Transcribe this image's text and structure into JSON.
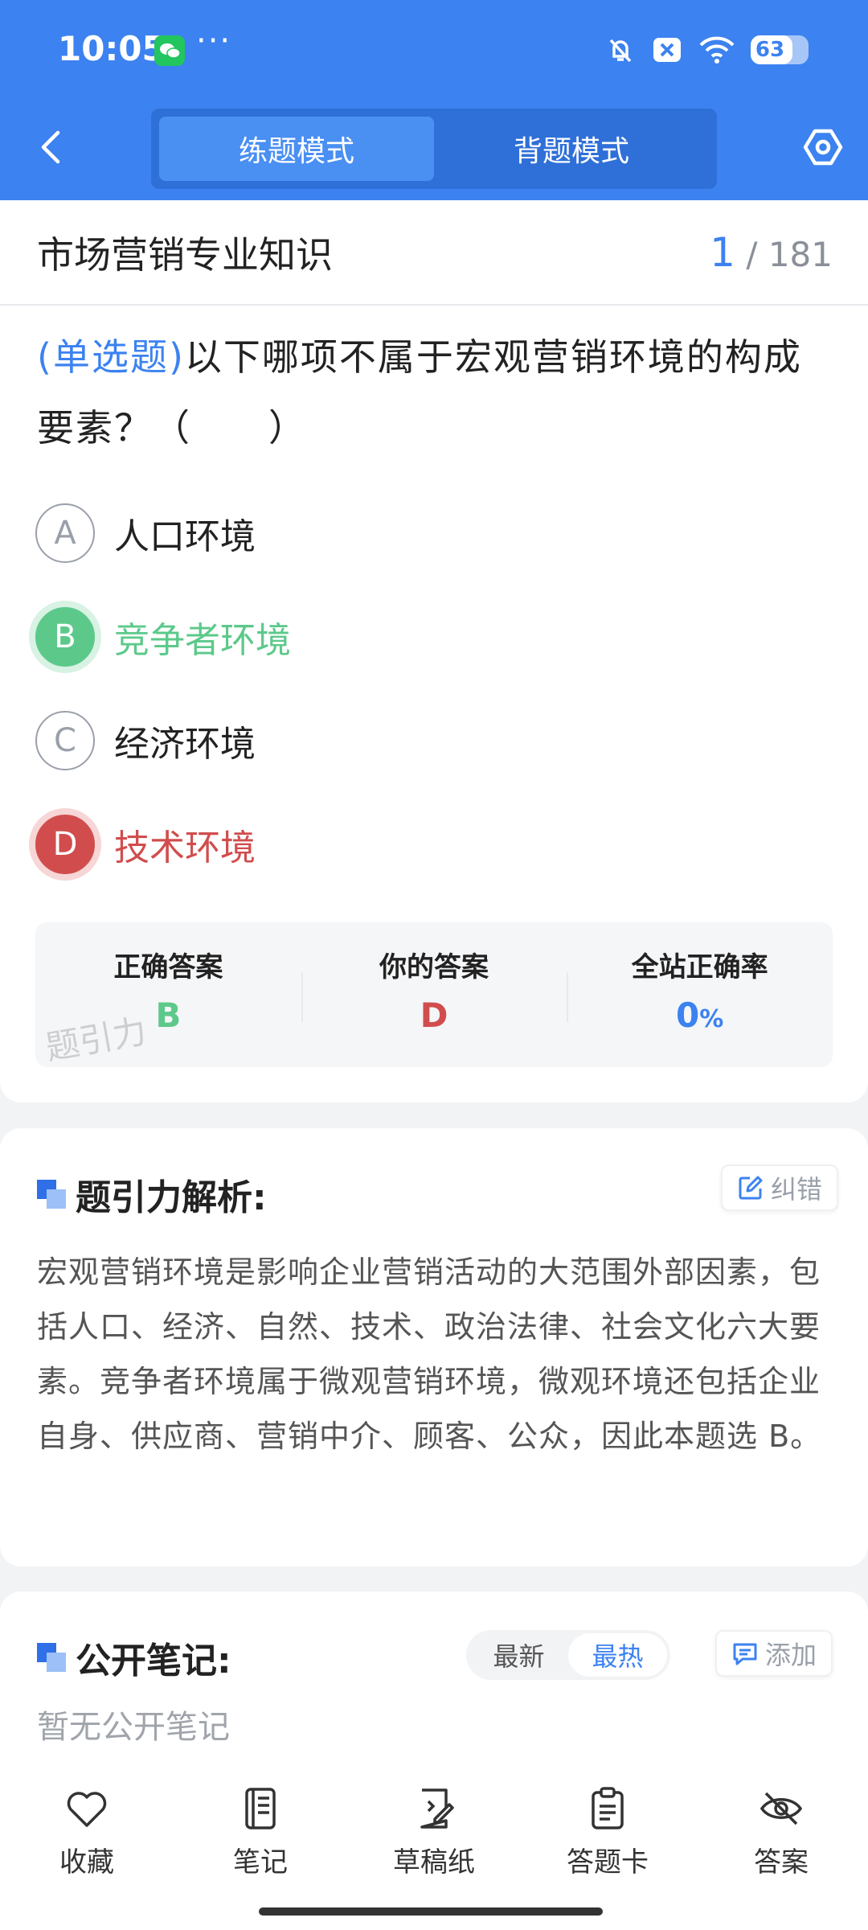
{
  "status_bar": {
    "time": "10:05",
    "dots": "···",
    "battery": "63",
    "icons": [
      "wechat-icon",
      "bell-off-icon",
      "close-box-icon",
      "wifi-icon",
      "battery-icon"
    ]
  },
  "header": {
    "tabs": [
      "练题模式",
      "背题模式"
    ],
    "active_tab": "练题模式"
  },
  "question": {
    "subject": "市场营销专业知识",
    "current": "1",
    "total": "/ 181",
    "type": "(单选题)",
    "text": "以下哪项不属于宏观营销环境的构成要素？（　　）",
    "options": [
      {
        "letter": "A",
        "text": "人口环境",
        "state": "normal"
      },
      {
        "letter": "B",
        "text": "竞争者环境",
        "state": "correct"
      },
      {
        "letter": "C",
        "text": "经济环境",
        "state": "normal"
      },
      {
        "letter": "D",
        "text": "技术环境",
        "state": "wrong"
      }
    ]
  },
  "answers": {
    "correct_label": "正确答案",
    "correct_value": "B",
    "yours_label": "你的答案",
    "yours_value": "D",
    "rate_label": "全站正确率",
    "rate_value": "0",
    "rate_unit": "%",
    "watermark": "题引力"
  },
  "analysis": {
    "title": "题引力解析:",
    "report_label": "纠错",
    "text": "宏观营销环境是影响企业营销活动的大范围外部因素，包括人口、经济、自然、技术、政治法律、社会文化六大要素。竞争者环境属于微观营销环境，微观环境还包括企业自身、供应商、营销中介、顾客、公众，因此本题选 B。"
  },
  "notes": {
    "title": "公开笔记:",
    "sort_options": [
      "最新",
      "最热"
    ],
    "active_sort": "最热",
    "add_label": "添加",
    "empty_text": "暂无公开笔记"
  },
  "toolbar": {
    "items": [
      {
        "label": "收藏",
        "icon": "heart-icon"
      },
      {
        "label": "笔记",
        "icon": "notebook-icon"
      },
      {
        "label": "草稿纸",
        "icon": "draft-icon"
      },
      {
        "label": "答题卡",
        "icon": "clipboard-icon"
      },
      {
        "label": "答案",
        "icon": "eye-off-icon"
      }
    ]
  },
  "colors": {
    "primary": "#3c82f0",
    "correct": "#5cc98a",
    "wrong": "#d14d4d"
  }
}
